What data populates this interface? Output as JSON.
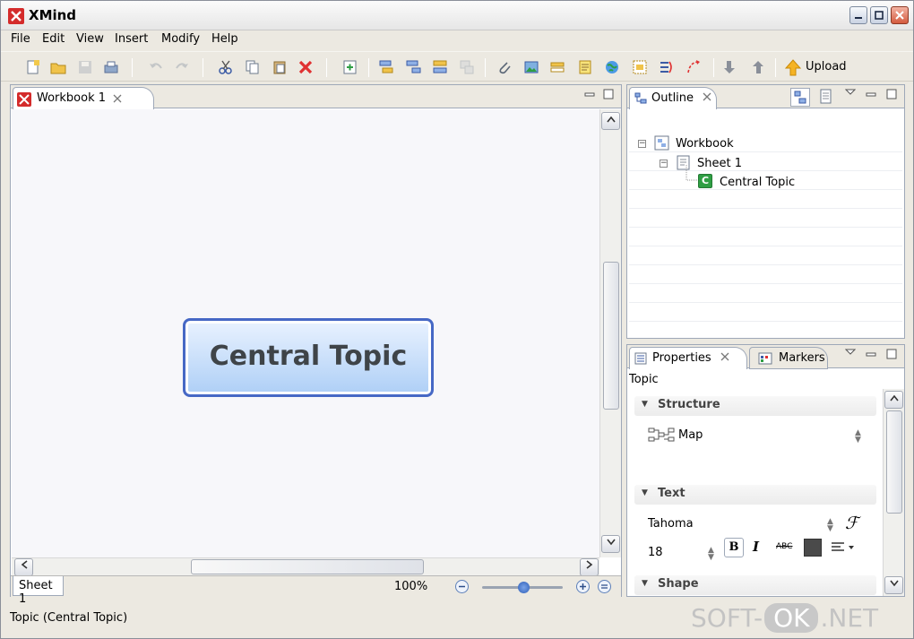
{
  "window": {
    "title": "XMind",
    "controls": [
      "minimize",
      "maximize",
      "close"
    ]
  },
  "menu": [
    "File",
    "Edit",
    "View",
    "Insert",
    "Modify",
    "Help"
  ],
  "toolbar": {
    "upload_label": "Upload"
  },
  "editor": {
    "tab_label": "Workbook 1",
    "central_topic": "Central Topic",
    "sheet_tab": "Sheet 1",
    "zoom": "100%"
  },
  "outline": {
    "tab_label": "Outline",
    "tree": [
      {
        "label": "Workbook",
        "icon": "workbook-icon"
      },
      {
        "label": "Sheet 1",
        "icon": "sheet-icon"
      },
      {
        "label": "Central Topic",
        "icon": "topic-icon",
        "icon_text": "C"
      }
    ]
  },
  "properties": {
    "tab_label": "Properties",
    "markers_tab": "Markers",
    "topic_label": "Topic",
    "structure": {
      "header": "Structure",
      "value": "Map"
    },
    "text": {
      "header": "Text",
      "font": "Tahoma",
      "size": "18",
      "strike_label": "ABC",
      "color": "#4a4a4a"
    },
    "shape": {
      "header": "Shape"
    }
  },
  "status": {
    "text": "Topic (Central Topic)"
  },
  "watermark": {
    "pre": "SOFT-",
    "ok": "OK",
    "post": ".NET"
  },
  "colors": {
    "brand": "#d42b2b",
    "topic_border": "#4668c5",
    "topic_fill": "#aecff6"
  }
}
